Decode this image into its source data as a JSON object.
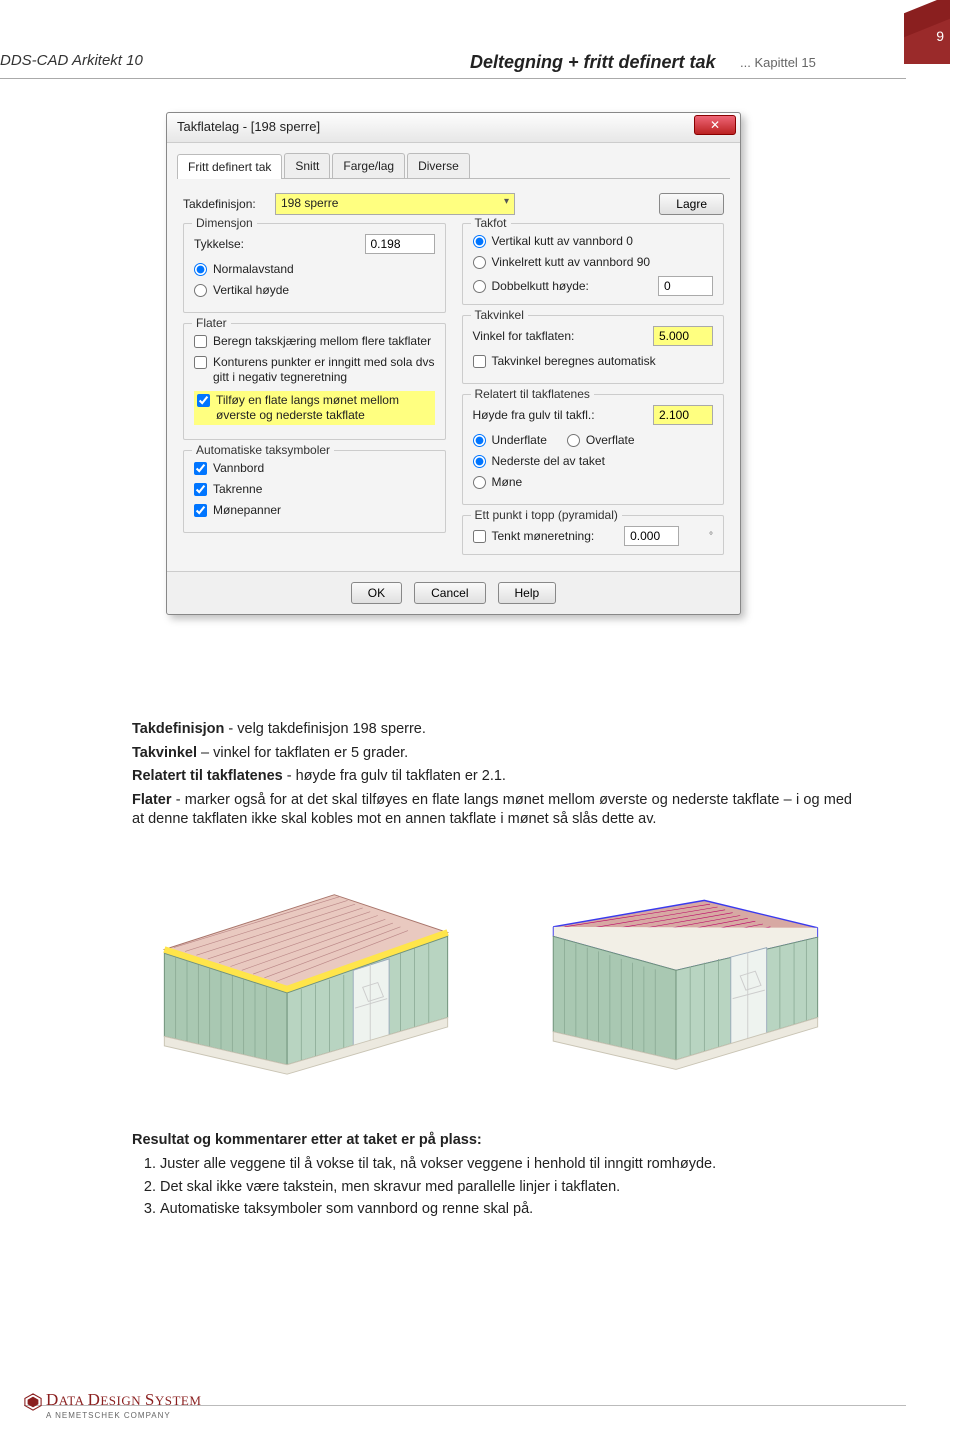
{
  "header": {
    "left": "DDS-CAD Arkitekt 10",
    "title": "Deltegning + fritt definert tak",
    "chapter": "... Kapittel 15",
    "pagenum": "9"
  },
  "dialog": {
    "title": "Takflatelag - [198 sperre]",
    "tabs": [
      "Fritt definert tak",
      "Snitt",
      "Farge/lag",
      "Diverse"
    ],
    "takdef_label": "Takdefinisjon:",
    "takdef_value": "198 sperre",
    "lagre": "Lagre",
    "dimensjon": {
      "title": "Dimensjon",
      "tykkelse_label": "Tykkelse:",
      "tykkelse_value": "0.198",
      "normalavstand": "Normalavstand",
      "vertikal": "Vertikal høyde"
    },
    "takfot": {
      "title": "Takfot",
      "v0": "Vertikal kutt av vannbord 0",
      "v90": "Vinkelrett kutt av vannbord 90",
      "dobbel_label": "Dobbelkutt høyde:",
      "dobbel_value": "0"
    },
    "flater": {
      "title": "Flater",
      "beregn": "Beregn takskjæring mellom flere takflater",
      "kontur": "Konturens punkter er inngitt med sola dvs gitt i negativ tegneretning",
      "tilfoy": "Tilføy en flate langs mønet mellom øverste og nederste takflate"
    },
    "autosym": {
      "title": "Automatiske taksymboler",
      "vannbord": "Vannbord",
      "takrenne": "Takrenne",
      "monepanner": "Mønepanner"
    },
    "takvinkel": {
      "title": "Takvinkel",
      "vinkel_label": "Vinkel for takflaten:",
      "vinkel_value": "5.000",
      "auto": "Takvinkel beregnes automatisk"
    },
    "relatert": {
      "title": "Relatert til takflatenes",
      "hoyde_label": "Høyde fra gulv til takfl.:",
      "hoyde_value": "2.100",
      "underflate": "Underflate",
      "overflate": "Overflate",
      "nederste": "Nederste del av taket",
      "mone": "Møne"
    },
    "pyramid": {
      "title": "Ett punkt i topp (pyramidal)",
      "tenkt_label": "Tenkt møneretning:",
      "tenkt_value": "0.000"
    },
    "buttons": {
      "ok": "OK",
      "cancel": "Cancel",
      "help": "Help"
    }
  },
  "bodytext": {
    "l1a": "Takdefinisjon",
    "l1b": " - velg takdefinisjon 198 sperre.",
    "l2a": "Takvinkel",
    "l2b": " – vinkel for takflaten er 5 grader.",
    "l3a": "Relatert til takflatenes",
    "l3b": " - høyde fra gulv til takflaten er 2.1.",
    "l4a": "Flater",
    "l4b": " - marker også for at det skal tilføyes en flate langs mønet mellom øverste og nederste takflate – i og med at denne takflaten ikke skal kobles mot en annen takflate i mønet så slås dette av."
  },
  "results": {
    "title": "Resultat og kommentarer etter at taket er på plass:",
    "items": [
      "Juster alle veggene til å vokse til tak, nå vokser veggene i henhold til inngitt romhøyde.",
      "Det skal ikke være takstein, men skravur med parallelle linjer i takflaten.",
      "Automatiske taksymboler som vannbord og renne skal på."
    ]
  },
  "footer": {
    "brand_caps": "D",
    "brand1": "ATA ",
    "brand2_caps": "D",
    "brand2": "ESIGN ",
    "brand3_caps": "S",
    "brand3": "YSTEM",
    "sub": "A NEMETSCHEK COMPANY"
  }
}
